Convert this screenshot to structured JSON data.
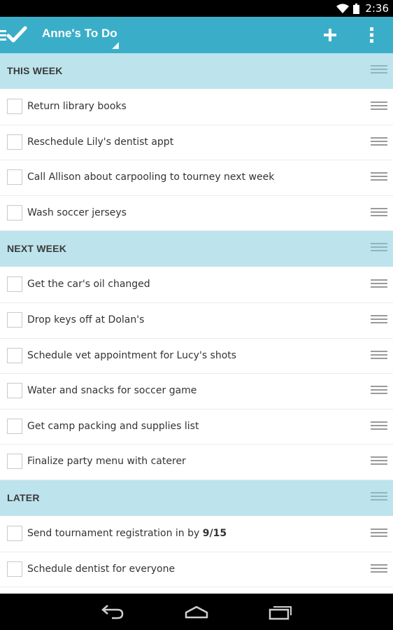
{
  "status_bar": {
    "time": "2:36",
    "icons": [
      "wifi-icon",
      "battery-icon"
    ]
  },
  "action_bar": {
    "app_icon": "menu-check-icon",
    "title": "Anne's To Do",
    "actions": [
      "add-icon",
      "overflow-menu-icon"
    ]
  },
  "sections": [
    {
      "title": "THIS WEEK",
      "items": [
        {
          "text": "Return library books"
        },
        {
          "text": "Reschedule Lily's dentist appt"
        },
        {
          "text": "Call Allison about carpooling to tourney next week"
        },
        {
          "text": "Wash soccer jerseys"
        }
      ]
    },
    {
      "title": "NEXT WEEK",
      "items": [
        {
          "text": "Get the car's oil changed"
        },
        {
          "text": "Drop keys off at Dolan's"
        },
        {
          "text": "Schedule vet appointment for Lucy's shots"
        },
        {
          "text": "Water and snacks for soccer game"
        },
        {
          "text": "Get camp packing and supplies list"
        },
        {
          "text": "Finalize party menu with caterer"
        }
      ]
    },
    {
      "title": "LATER",
      "items": [
        {
          "text": "Send tournament registration in by ",
          "bold": "9/15"
        },
        {
          "text": "Schedule dentist for everyone"
        }
      ]
    }
  ],
  "nav_bar": {
    "buttons": [
      "back-icon",
      "home-icon",
      "recent-apps-icon"
    ]
  },
  "colors": {
    "action_bar": "#3aaec9",
    "section_header": "#bde3ec",
    "text": "#333333"
  }
}
